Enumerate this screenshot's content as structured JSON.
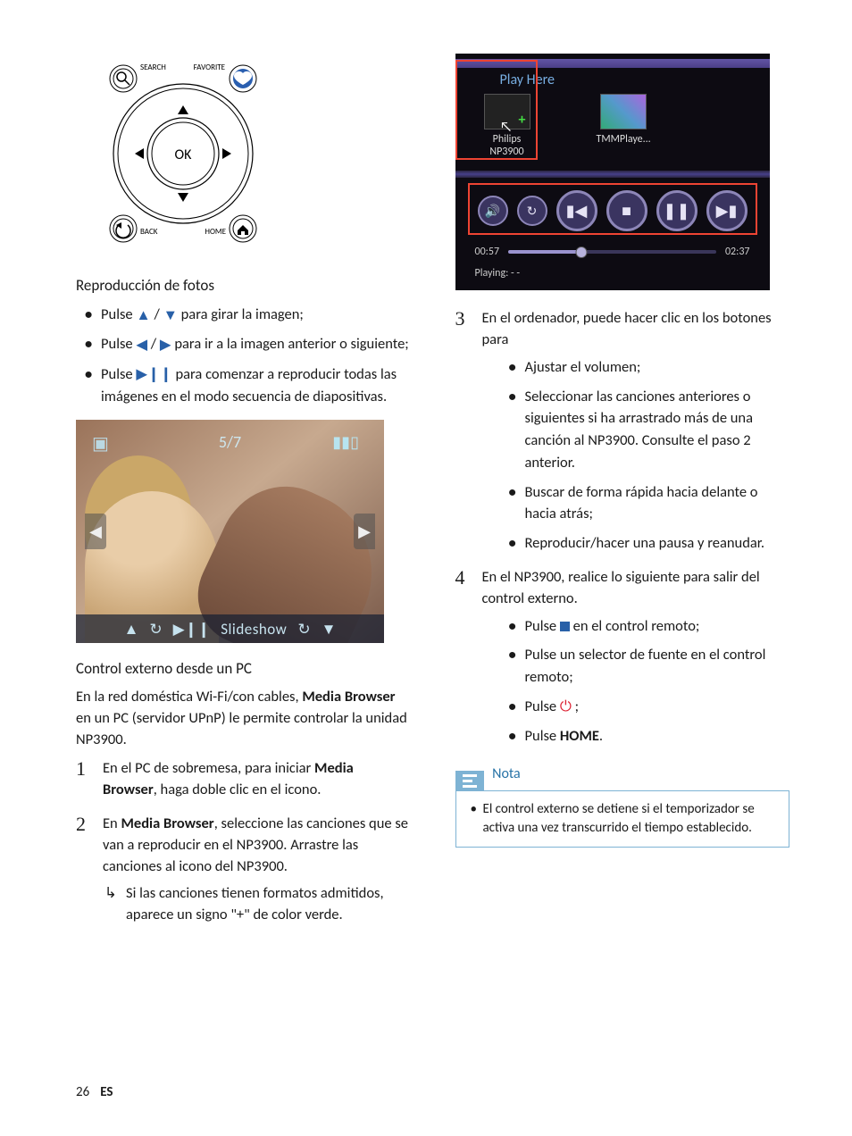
{
  "remote": {
    "search_label": "SEARCH",
    "favorite_label": "FAVORITE",
    "ok_label": "OK",
    "back_label": "BACK",
    "home_label": "HOME"
  },
  "left": {
    "photo_heading": "Reproducción de fotos",
    "bullets": {
      "b1_pre": "Pulse ",
      "b1_post": " para girar la imagen;",
      "b2_pre": "Pulse ",
      "b2_post": " para ir a la imagen anterior o siguiente;",
      "b3_pre": "Pulse ",
      "b3_post": " para comenzar a reproducir todas las imágenes en el modo secuencia de diapositivas."
    },
    "photo": {
      "counter": "5/7",
      "slideshow_label": "Slideshow"
    },
    "pc_heading": "Control externo desde un PC",
    "pc_intro_pre": "En la red doméstica Wi-Fi/con cables, ",
    "pc_intro_bold1": "Media Browser",
    "pc_intro_mid": " en un PC (servidor UPnP) le permite controlar la unidad NP3900.",
    "step1_pre": "En el PC de sobremesa, para iniciar ",
    "step1_bold": "Media Browser",
    "step1_post": ", haga doble clic en el icono.",
    "step2_pre": "En ",
    "step2_bold": "Media Browser",
    "step2_post": ", seleccione las canciones que se van a reproducir en el NP3900. Arrastre las canciones al icono del NP3900.",
    "step2_arrow": "Si las canciones tienen formatos admitidos, aparece un signo \"+\" de color verde."
  },
  "player": {
    "play_here": "Play Here",
    "dev1_label": "Philips NP3900",
    "dev2_label": "TMMPlaye...",
    "time_current": "00:57",
    "time_total": "02:37",
    "status_label": "Playing:  - -"
  },
  "right": {
    "step3_intro": "En el ordenador, puede hacer clic en los botones para",
    "step3": {
      "b1": "Ajustar el volumen;",
      "b2": "Seleccionar las canciones anteriores o siguientes si ha arrastrado más de una canción al NP3900. Consulte el paso 2 anterior.",
      "b3": "Buscar de forma rápida hacia delante o hacia atrás;",
      "b4": "Reproducir/hacer una pausa y reanudar."
    },
    "step4_intro": "En el NP3900, realice lo siguiente para salir del control externo.",
    "step4": {
      "b1_pre": "Pulse ",
      "b1_post": " en el control remoto;",
      "b2": "Pulse un selector de fuente en el control remoto;",
      "b3_pre": "Pulse ",
      "b3_post": " ;",
      "b4_pre": "Pulse ",
      "b4_bold": "HOME",
      "b4_post": "."
    },
    "nota_label": "Nota",
    "nota_text": "El control externo se detiene si el temporizador se activa una vez transcurrido el tiempo establecido."
  },
  "footer": {
    "page": "26",
    "lang": "ES"
  }
}
